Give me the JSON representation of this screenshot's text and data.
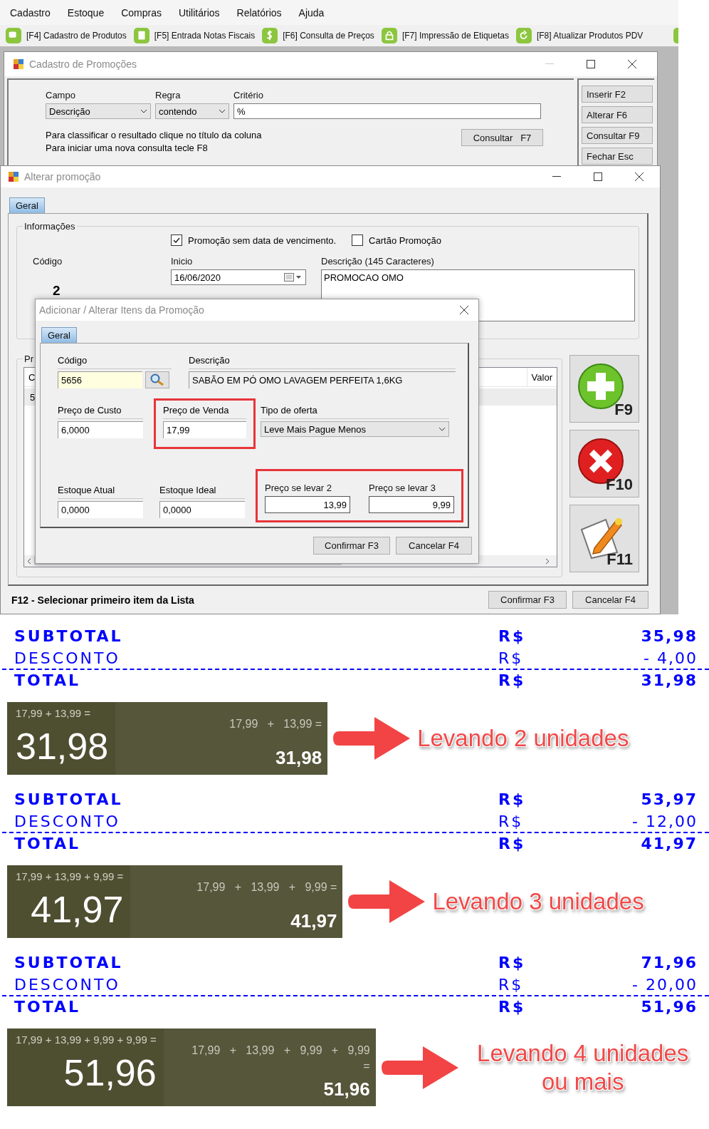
{
  "menu": [
    "Cadastro",
    "Estoque",
    "Compras",
    "Utilitários",
    "Relatórios",
    "Ajuda"
  ],
  "toolbar": [
    {
      "label": "[F4] Cadastro de Produtos",
      "kind": "window"
    },
    {
      "label": "[F5] Entrada Notas Fiscais",
      "kind": "document"
    },
    {
      "label": "[F6] Consulta de Preços",
      "kind": "dollar"
    },
    {
      "label": "[F7] Impressão de Etiquetas",
      "kind": "lock"
    },
    {
      "label": "[F8] Atualizar Produtos PDV",
      "kind": "refresh"
    }
  ],
  "search_window": {
    "title": "Cadastro de Promoções",
    "campo": {
      "label": "Campo",
      "value": "Descrição"
    },
    "regra": {
      "label": "Regra",
      "value": "contendo"
    },
    "criterio": {
      "label": "Critério",
      "value": "%"
    },
    "hints": [
      "Para classificar o resultado clique no título da coluna",
      "Para iniciar uma nova consulta tecle F8"
    ],
    "search_button": "Consultar   F7",
    "side_buttons": [
      "Inserir F2",
      "Alterar F6",
      "Consultar F9",
      "Fechar Esc"
    ]
  },
  "edit_window": {
    "title": "Alterar promoção",
    "tab": {
      "label": "Geral",
      "selected": true
    },
    "group_title": "Informações",
    "checkboxes": [
      {
        "label": "Promoção sem data de vencimento.",
        "checked": true
      },
      {
        "label": "Cartão Promoção",
        "checked": false
      }
    ],
    "codigo": {
      "label": "Código",
      "value": "2"
    },
    "inicio": {
      "label": "Inicio",
      "value": "16/06/2020"
    },
    "descricao": {
      "label": "Descrição (145 Caracteres)",
      "value": "PROMOCAO OMO"
    },
    "products": {
      "title": "Pr",
      "column_1": "C",
      "column_2": "Valor",
      "row_1": "5"
    },
    "action_buttons": [
      {
        "key": "F9",
        "kind": "add"
      },
      {
        "key": "F10",
        "kind": "delete"
      },
      {
        "key": "F11",
        "kind": "edit"
      }
    ],
    "footer_hint": "F12 - Selecionar primeiro item da Lista",
    "buttons": [
      "Confirmar F3",
      "Cancelar F4"
    ]
  },
  "item_dialog": {
    "title": "Adicionar / Alterar Itens da Promoção",
    "tab": {
      "label": "Geral",
      "selected": true
    },
    "codigo": {
      "label": "Código",
      "value": "5656"
    },
    "descricao": {
      "label": "Descrição",
      "value": "SABÃO EM PÓ OMO LAVAGEM PERFEITA 1,6KG"
    },
    "preco_custo": {
      "label": "Preço de Custo",
      "value": "6,0000"
    },
    "preco_venda": {
      "label": "Preço de Venda",
      "value": "17,99",
      "highlighted": true
    },
    "tipo_oferta": {
      "label": "Tipo de oferta",
      "value": "Leve Mais Pague Menos"
    },
    "estoque_atual": {
      "label": "Estoque Atual",
      "value": "0,0000"
    },
    "estoque_ideal": {
      "label": "Estoque Ideal",
      "value": "0,0000"
    },
    "levar_group": {
      "highlighted": true,
      "fields": [
        {
          "label": "Preço se levar 2",
          "value": "13,99"
        },
        {
          "label": "Preço se levar 3",
          "value": "9,99"
        }
      ]
    },
    "buttons": [
      "Confirmar F3",
      "Cancelar F4"
    ]
  },
  "examples": [
    {
      "totals": [
        {
          "kind": "subtotal",
          "label": "SUBTOTAL",
          "currency": "R$",
          "value": "35,98"
        },
        {
          "kind": "discount",
          "label": "DESCONTO",
          "currency": "R$",
          "value": "- 4,00"
        },
        {
          "kind": "total",
          "label": "TOTAL",
          "currency": "R$",
          "value": "31,98"
        }
      ],
      "display": {
        "expression": "17,99 + 13,99 =",
        "total": "31,98",
        "detail_lines": [
          "17,99   +   13,99 ="
        ],
        "detail_total": "31,98"
      },
      "note": "Levando 2 unidades"
    },
    {
      "totals": [
        {
          "kind": "subtotal",
          "label": "SUBTOTAL",
          "currency": "R$",
          "value": "53,97"
        },
        {
          "kind": "discount",
          "label": "DESCONTO",
          "currency": "R$",
          "value": "- 12,00"
        },
        {
          "kind": "total",
          "label": "TOTAL",
          "currency": "R$",
          "value": "41,97"
        }
      ],
      "display": {
        "expression": "17,99 + 13,99 + 9,99 =",
        "total": "41,97",
        "detail_lines": [
          "17,99   +   13,99   +   9,99 ="
        ],
        "detail_total": "41,97"
      },
      "note": "Levando 3 unidades"
    },
    {
      "totals": [
        {
          "kind": "subtotal",
          "label": "SUBTOTAL",
          "currency": "R$",
          "value": "71,96"
        },
        {
          "kind": "discount",
          "label": "DESCONTO",
          "currency": "R$",
          "value": "- 20,00"
        },
        {
          "kind": "total",
          "label": "TOTAL",
          "currency": "R$",
          "value": "51,96"
        }
      ],
      "display": {
        "expression": "17,99 + 13,99 + 9,99 + 9,99 =",
        "total": "51,96",
        "detail_lines": [
          "17,99   +   13,99   +   9,99   +   9,99",
          "="
        ],
        "detail_total": "51,96"
      },
      "note": "Levando 4 unidades ou mais"
    }
  ]
}
